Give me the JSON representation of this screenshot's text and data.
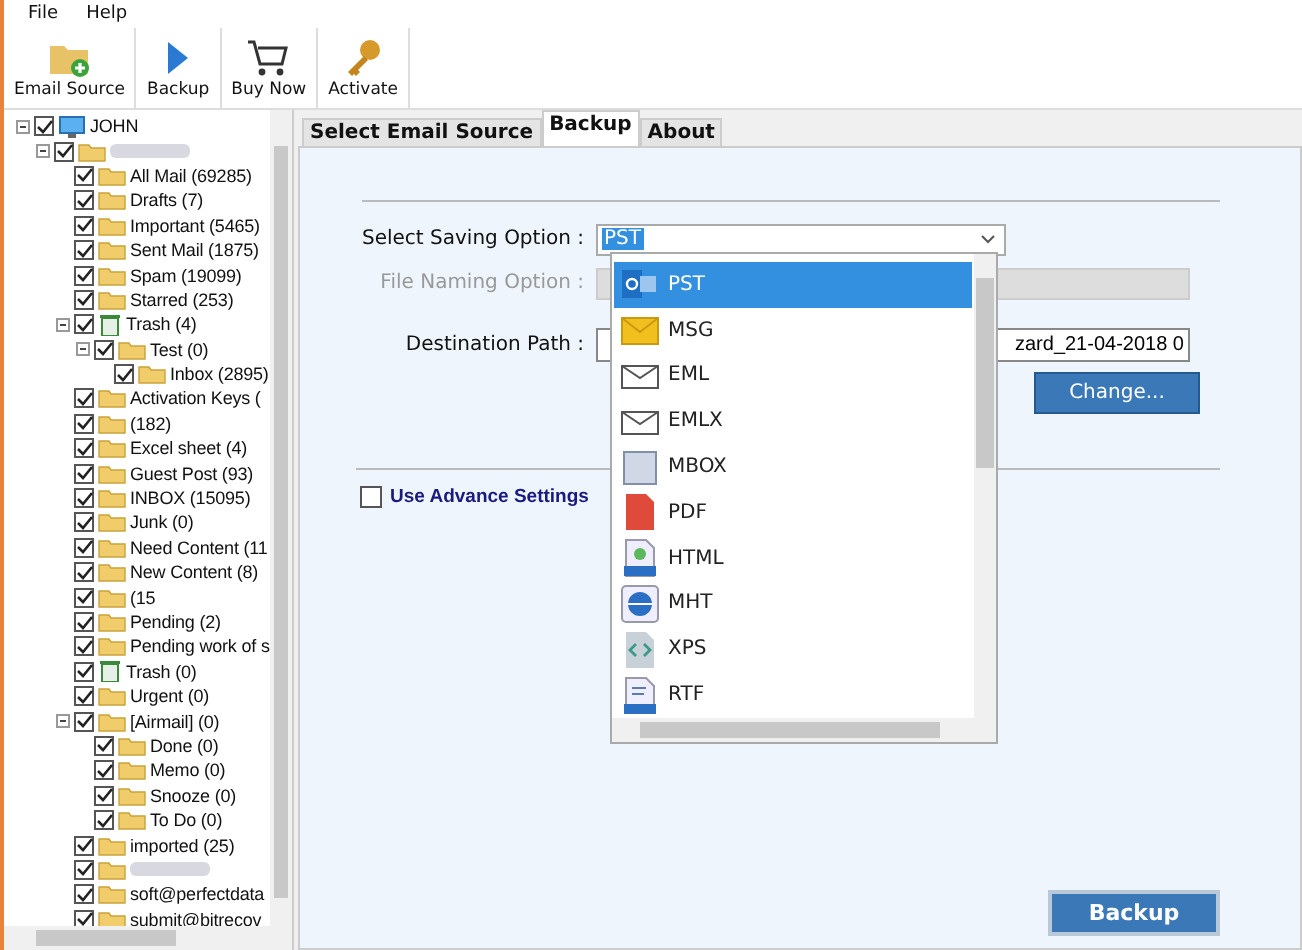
{
  "menu": [
    "File",
    "Help"
  ],
  "toolbar": [
    {
      "label": "Email Source",
      "kind": "folder-add"
    },
    {
      "label": "Backup",
      "kind": "play"
    },
    {
      "label": "Buy Now",
      "kind": "cart"
    },
    {
      "label": "Activate",
      "kind": "key"
    }
  ],
  "tree": [
    {
      "label": "JOHN",
      "kind": "computer",
      "checked": true,
      "expanded": true,
      "children": [
        {
          "kind": "folder",
          "checked": true,
          "expanded": true,
          "children": [
            {
              "label": "All Mail (69285)",
              "kind": "folder",
              "checked": true
            },
            {
              "label": "Drafts (7)",
              "kind": "folder",
              "checked": true
            },
            {
              "label": "Important (5465)",
              "kind": "folder",
              "checked": true
            },
            {
              "label": "Sent Mail (1875)",
              "kind": "folder",
              "checked": true
            },
            {
              "label": "Spam (19099)",
              "kind": "folder",
              "checked": true
            },
            {
              "label": "Starred (253)",
              "kind": "folder",
              "checked": true
            },
            {
              "label": "Trash (4)",
              "kind": "trash",
              "checked": true,
              "expanded": true,
              "children": [
                {
                  "label": "Test (0)",
                  "kind": "folder",
                  "checked": true,
                  "expanded": true,
                  "children": [
                    {
                      "label": "Inbox (2895)",
                      "kind": "folder",
                      "checked": true
                    }
                  ]
                }
              ]
            },
            {
              "label": "Activation Keys (",
              "kind": "folder",
              "checked": true
            },
            {
              "label": "(182)",
              "kind": "folder",
              "checked": true
            },
            {
              "label": "Excel sheet (4)",
              "kind": "folder",
              "checked": true
            },
            {
              "label": "Guest Post (93)",
              "kind": "folder",
              "checked": true
            },
            {
              "label": "INBOX (15095)",
              "kind": "folder",
              "checked": true
            },
            {
              "label": "Junk (0)",
              "kind": "folder",
              "checked": true
            },
            {
              "label": "Need Content (11",
              "kind": "folder",
              "checked": true
            },
            {
              "label": "New Content (8)",
              "kind": "folder",
              "checked": true
            },
            {
              "label": "(15",
              "kind": "folder",
              "checked": true
            },
            {
              "label": "Pending (2)",
              "kind": "folder",
              "checked": true
            },
            {
              "label": "Pending work of s",
              "kind": "folder",
              "checked": true
            },
            {
              "label": "Trash (0)",
              "kind": "trash",
              "checked": true
            },
            {
              "label": "Urgent (0)",
              "kind": "folder",
              "checked": true
            },
            {
              "label": "[Airmail] (0)",
              "kind": "folder",
              "checked": true,
              "expanded": true,
              "children": [
                {
                  "label": "Done (0)",
                  "kind": "folder",
                  "checked": true
                },
                {
                  "label": "Memo (0)",
                  "kind": "folder",
                  "checked": true
                },
                {
                  "label": "Snooze (0)",
                  "kind": "folder",
                  "checked": true
                },
                {
                  "label": "To Do (0)",
                  "kind": "folder",
                  "checked": true
                }
              ]
            },
            {
              "label": "imported (25)",
              "kind": "folder",
              "checked": true
            },
            {
              "kind": "folder",
              "checked": true
            },
            {
              "label": "soft@perfectdata",
              "kind": "folder",
              "checked": true
            },
            {
              "label": "submit@bitrecov",
              "kind": "folder",
              "checked": true
            }
          ]
        }
      ]
    }
  ],
  "tabs": [
    {
      "label": "Select Email Source",
      "selected": false
    },
    {
      "label": "Backup",
      "selected": true
    },
    {
      "label": "About",
      "selected": false
    }
  ],
  "saving_option": {
    "label": "Select Saving Option :",
    "value": "PST"
  },
  "file_naming": {
    "label": "File Naming Option :",
    "disabled": true
  },
  "destination": {
    "label": "Destination Path :",
    "value": "zard_21-04-2018 0"
  },
  "change_button": "Change...",
  "advanced": {
    "label": "Use Advance Settings",
    "checked": false
  },
  "formats": [
    {
      "label": "PST",
      "kind": "outlook",
      "selected": true
    },
    {
      "label": "MSG",
      "kind": "envelope-yellow",
      "selected": false
    },
    {
      "label": "EML",
      "kind": "envelope",
      "selected": false
    },
    {
      "label": "EMLX",
      "kind": "envelope",
      "selected": false
    },
    {
      "label": "MBOX",
      "kind": "mbox",
      "selected": false
    },
    {
      "label": "PDF",
      "kind": "pdf",
      "selected": false
    },
    {
      "label": "HTML",
      "kind": "html",
      "selected": false
    },
    {
      "label": "MHT",
      "kind": "globe",
      "selected": false
    },
    {
      "label": "XPS",
      "kind": "code",
      "selected": false
    },
    {
      "label": "RTF",
      "kind": "rtf",
      "selected": false
    }
  ],
  "backup_button": "Backup"
}
